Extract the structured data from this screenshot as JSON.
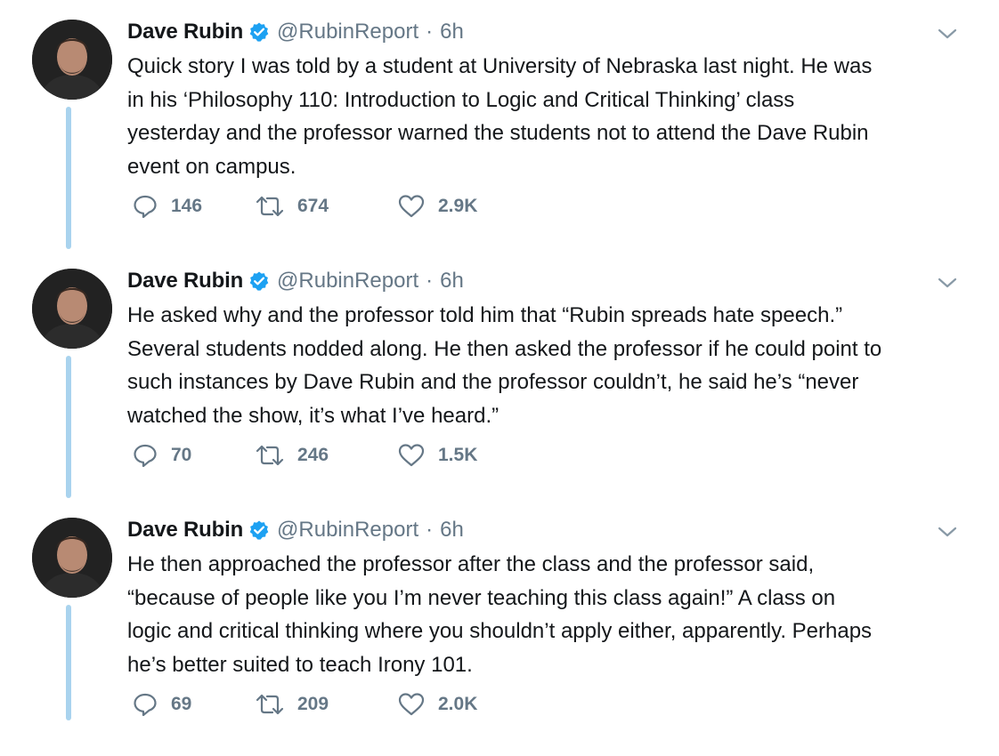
{
  "colors": {
    "verified": "#1da1f2",
    "thread_line": "#a9d3ee",
    "secondary_text": "#657786",
    "primary_text": "#14171a"
  },
  "tweets": [
    {
      "name": "Dave Rubin",
      "handle": "@RubinReport",
      "separator": "·",
      "time": "6h",
      "text": "Quick story I was told by a student at University of Nebraska last night. He was\nin his ‘Philosophy 110: Introduction to Logic and Critical Thinking’ class\nyesterday and the professor warned the students not to attend the Dave Rubin\nevent on campus.",
      "replies": "146",
      "retweets": "674",
      "likes": "2.9K"
    },
    {
      "name": "Dave Rubin",
      "handle": "@RubinReport",
      "separator": "·",
      "time": "6h",
      "text": "He asked why and the professor told him that “Rubin spreads hate speech.”\nSeveral students nodded along. He then asked the professor if he could point to\nsuch instances by Dave Rubin and the professor couldn’t, he said he’s “never\nwatched the show, it’s what I’ve heard.”",
      "replies": "70",
      "retweets": "246",
      "likes": "1.5K"
    },
    {
      "name": "Dave Rubin",
      "handle": "@RubinReport",
      "separator": "·",
      "time": "6h",
      "text": "He then approached the professor after the class and the professor said,\n“because of people like you I’m never teaching this class again!” A class on\nlogic and critical thinking where you shouldn’t apply either, apparently. Perhaps\nhe’s better suited to teach Irony 101.",
      "replies": "69",
      "retweets": "209",
      "likes": "2.0K"
    }
  ]
}
